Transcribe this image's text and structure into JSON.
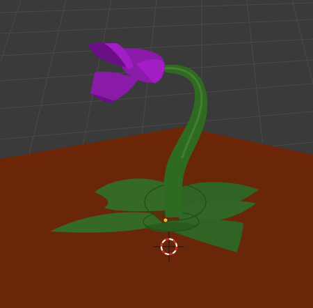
{
  "viewport": {
    "view": "3D Viewport",
    "shading": "solid"
  },
  "colors": {
    "background": "#3a3a3a",
    "grid_line": "#4a4a4a",
    "ground_plane": "#6a2608",
    "leaf": "#356a26",
    "leaf_dark": "#2a5a1e",
    "leaf_vein": "#244d18",
    "stem": "#2f6a22",
    "stem_highlight": "#4a8a34",
    "petal": "#8a1aa8",
    "petal_light": "#a21ec4",
    "petal_shadow": "#6a0f86",
    "origin_point": "#f0c020",
    "cursor_ring_red": "#e02020",
    "cursor_ring_white": "#ffffff"
  },
  "objects": [
    {
      "name": "ground_plane",
      "kind": "plane"
    },
    {
      "name": "leaf_rosette",
      "kind": "mesh"
    },
    {
      "name": "flower_stem",
      "kind": "mesh"
    },
    {
      "name": "flower_bloom",
      "kind": "mesh"
    }
  ],
  "overlays": {
    "origin_marker": "object-origin",
    "cursor_3d": "3d-cursor"
  }
}
